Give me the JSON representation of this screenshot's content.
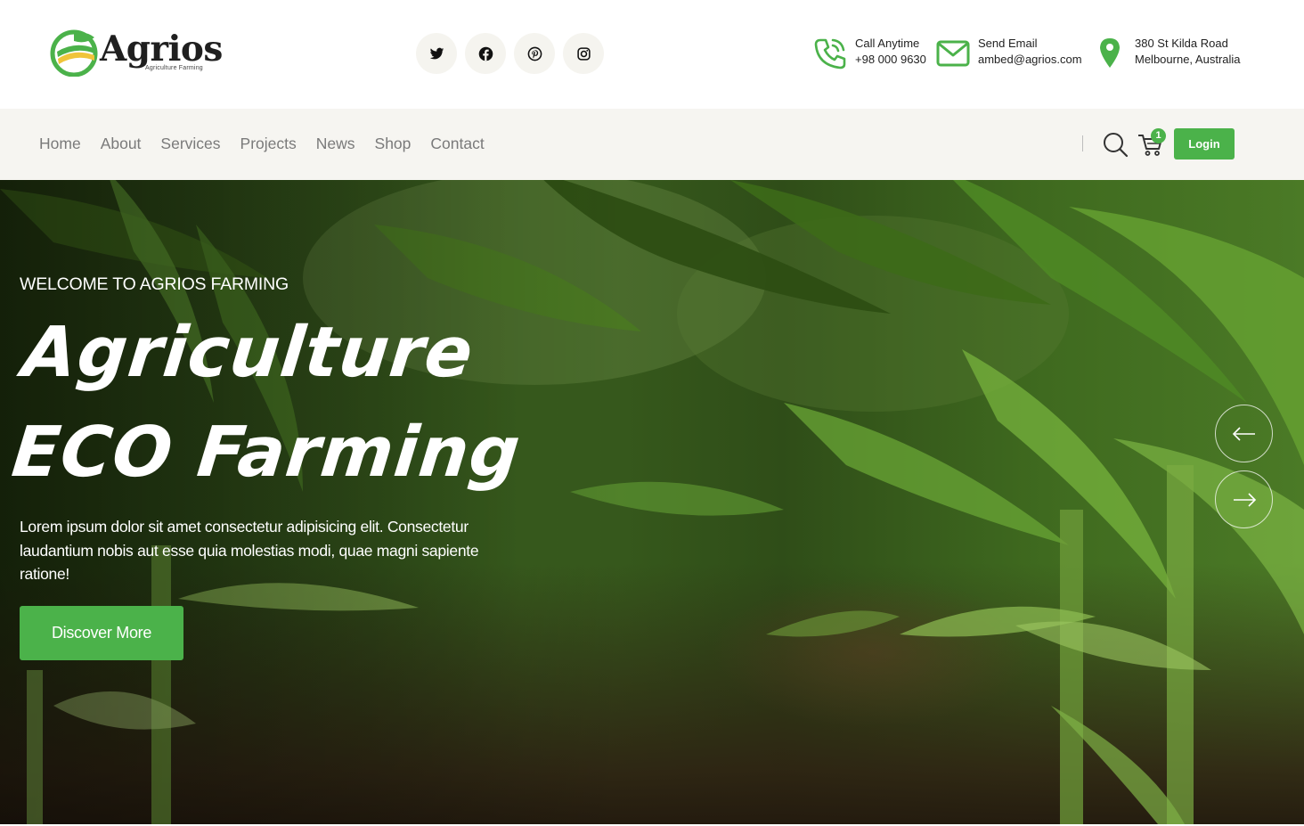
{
  "brand": {
    "name": "Agrios",
    "tagline": "Agriculture Farming"
  },
  "socials": [
    {
      "icon": "twitter-icon"
    },
    {
      "icon": "facebook-icon"
    },
    {
      "icon": "pinterest-icon"
    },
    {
      "icon": "instagram-icon"
    }
  ],
  "contact": {
    "call_label": "Call Anytime",
    "call_value": "+98 000 9630",
    "email_label": "Send Email",
    "email_value": "ambed@agrios.com",
    "address_line1": "380 St Kilda Road",
    "address_line2": "Melbourne, Australia"
  },
  "nav": {
    "items": [
      "Home",
      "About",
      "Services",
      "Projects",
      "News",
      "Shop",
      "Contact"
    ],
    "cart_count": "1",
    "login_label": "Login"
  },
  "hero": {
    "subtitle": "WELCOME TO AGRIOS FARMING",
    "title_line1": "Agriculture",
    "title_line2": "ECO Farming",
    "description": "Lorem ipsum dolor sit amet consectetur adipisicing elit. Consectetur laudantium nobis aut esse quia molestias modi, quae magni sapiente ratione!",
    "cta_label": "Discover More"
  },
  "colors": {
    "accent": "#4bb24a",
    "nav_bg": "#f6f5f1",
    "social_bg": "#f5f4ef",
    "text_dark": "#222222",
    "nav_text": "#7a7a7a"
  }
}
